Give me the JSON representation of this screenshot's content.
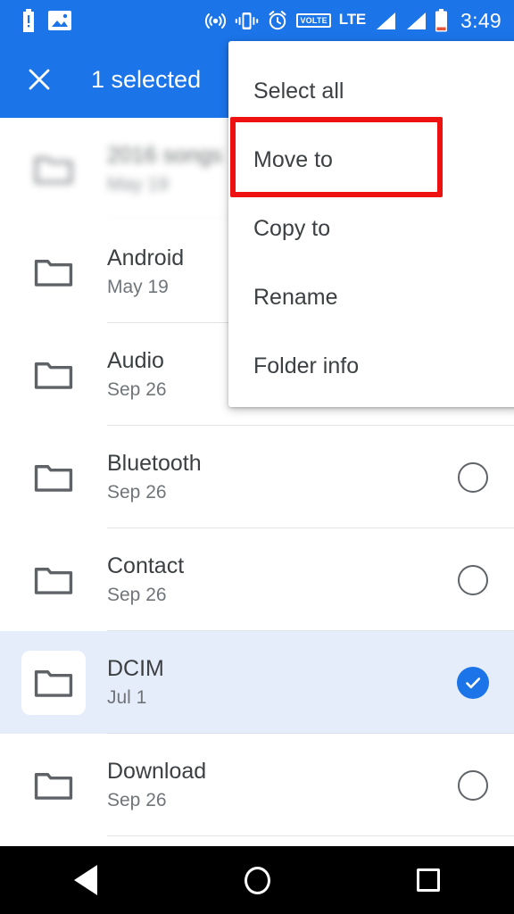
{
  "status_bar": {
    "time": "3:49",
    "left_icons": [
      {
        "name": "battery-alert-icon",
        "glyph": "battery-alert"
      },
      {
        "name": "image-icon",
        "glyph": "photo"
      }
    ],
    "right_icons": [
      {
        "name": "hotspot-icon",
        "glyph": "hotspot"
      },
      {
        "name": "vibrate-icon",
        "glyph": "vibrate"
      },
      {
        "name": "alarm-icon",
        "glyph": "alarm"
      },
      {
        "name": "volte-icon",
        "glyph": "VOLTE"
      },
      {
        "name": "lte-icon",
        "glyph": "LTE"
      },
      {
        "name": "signal-1-icon",
        "glyph": "signal"
      },
      {
        "name": "signal-2-icon",
        "glyph": "signal"
      },
      {
        "name": "battery-icon",
        "glyph": "battery-low"
      }
    ],
    "volte_label": "VOLTE",
    "lte_label": "LTE"
  },
  "action_bar": {
    "close_icon": "close-icon",
    "title": "1 selected",
    "background": "#1B74E8"
  },
  "menu": {
    "items": [
      {
        "label": "Select all",
        "name": "menu-item-select-all",
        "highlighted": false
      },
      {
        "label": "Move to",
        "name": "menu-item-move-to",
        "highlighted": true
      },
      {
        "label": "Copy to",
        "name": "menu-item-copy-to",
        "highlighted": false
      },
      {
        "label": "Rename",
        "name": "menu-item-rename",
        "highlighted": false
      },
      {
        "label": "Folder info",
        "name": "menu-item-folder-info",
        "highlighted": false
      }
    ],
    "highlight_color": "#EE1111"
  },
  "file_list": {
    "rows": [
      {
        "name": "2016 songs",
        "date": "May 19",
        "selected": false,
        "blurred": true,
        "checkbox": "hidden"
      },
      {
        "name": "Android",
        "date": "May 19",
        "selected": false,
        "blurred": false,
        "checkbox": "hidden"
      },
      {
        "name": "Audio",
        "date": "Sep 26",
        "selected": false,
        "blurred": false,
        "checkbox": "hidden"
      },
      {
        "name": "Bluetooth",
        "date": "Sep 26",
        "selected": false,
        "blurred": false,
        "checkbox": "empty"
      },
      {
        "name": "Contact",
        "date": "Sep 26",
        "selected": false,
        "blurred": false,
        "checkbox": "empty"
      },
      {
        "name": "DCIM",
        "date": "Jul 1",
        "selected": true,
        "blurred": false,
        "checkbox": "checked"
      },
      {
        "name": "Download",
        "date": "Sep 26",
        "selected": false,
        "blurred": false,
        "checkbox": "empty"
      }
    ],
    "selected_row_background": "#E6EDFA",
    "folder_icon": "folder-icon",
    "check_color": "#1B74E8"
  },
  "nav_bar": {
    "back_label": "Back",
    "home_label": "Home",
    "recents_label": "Recents"
  }
}
